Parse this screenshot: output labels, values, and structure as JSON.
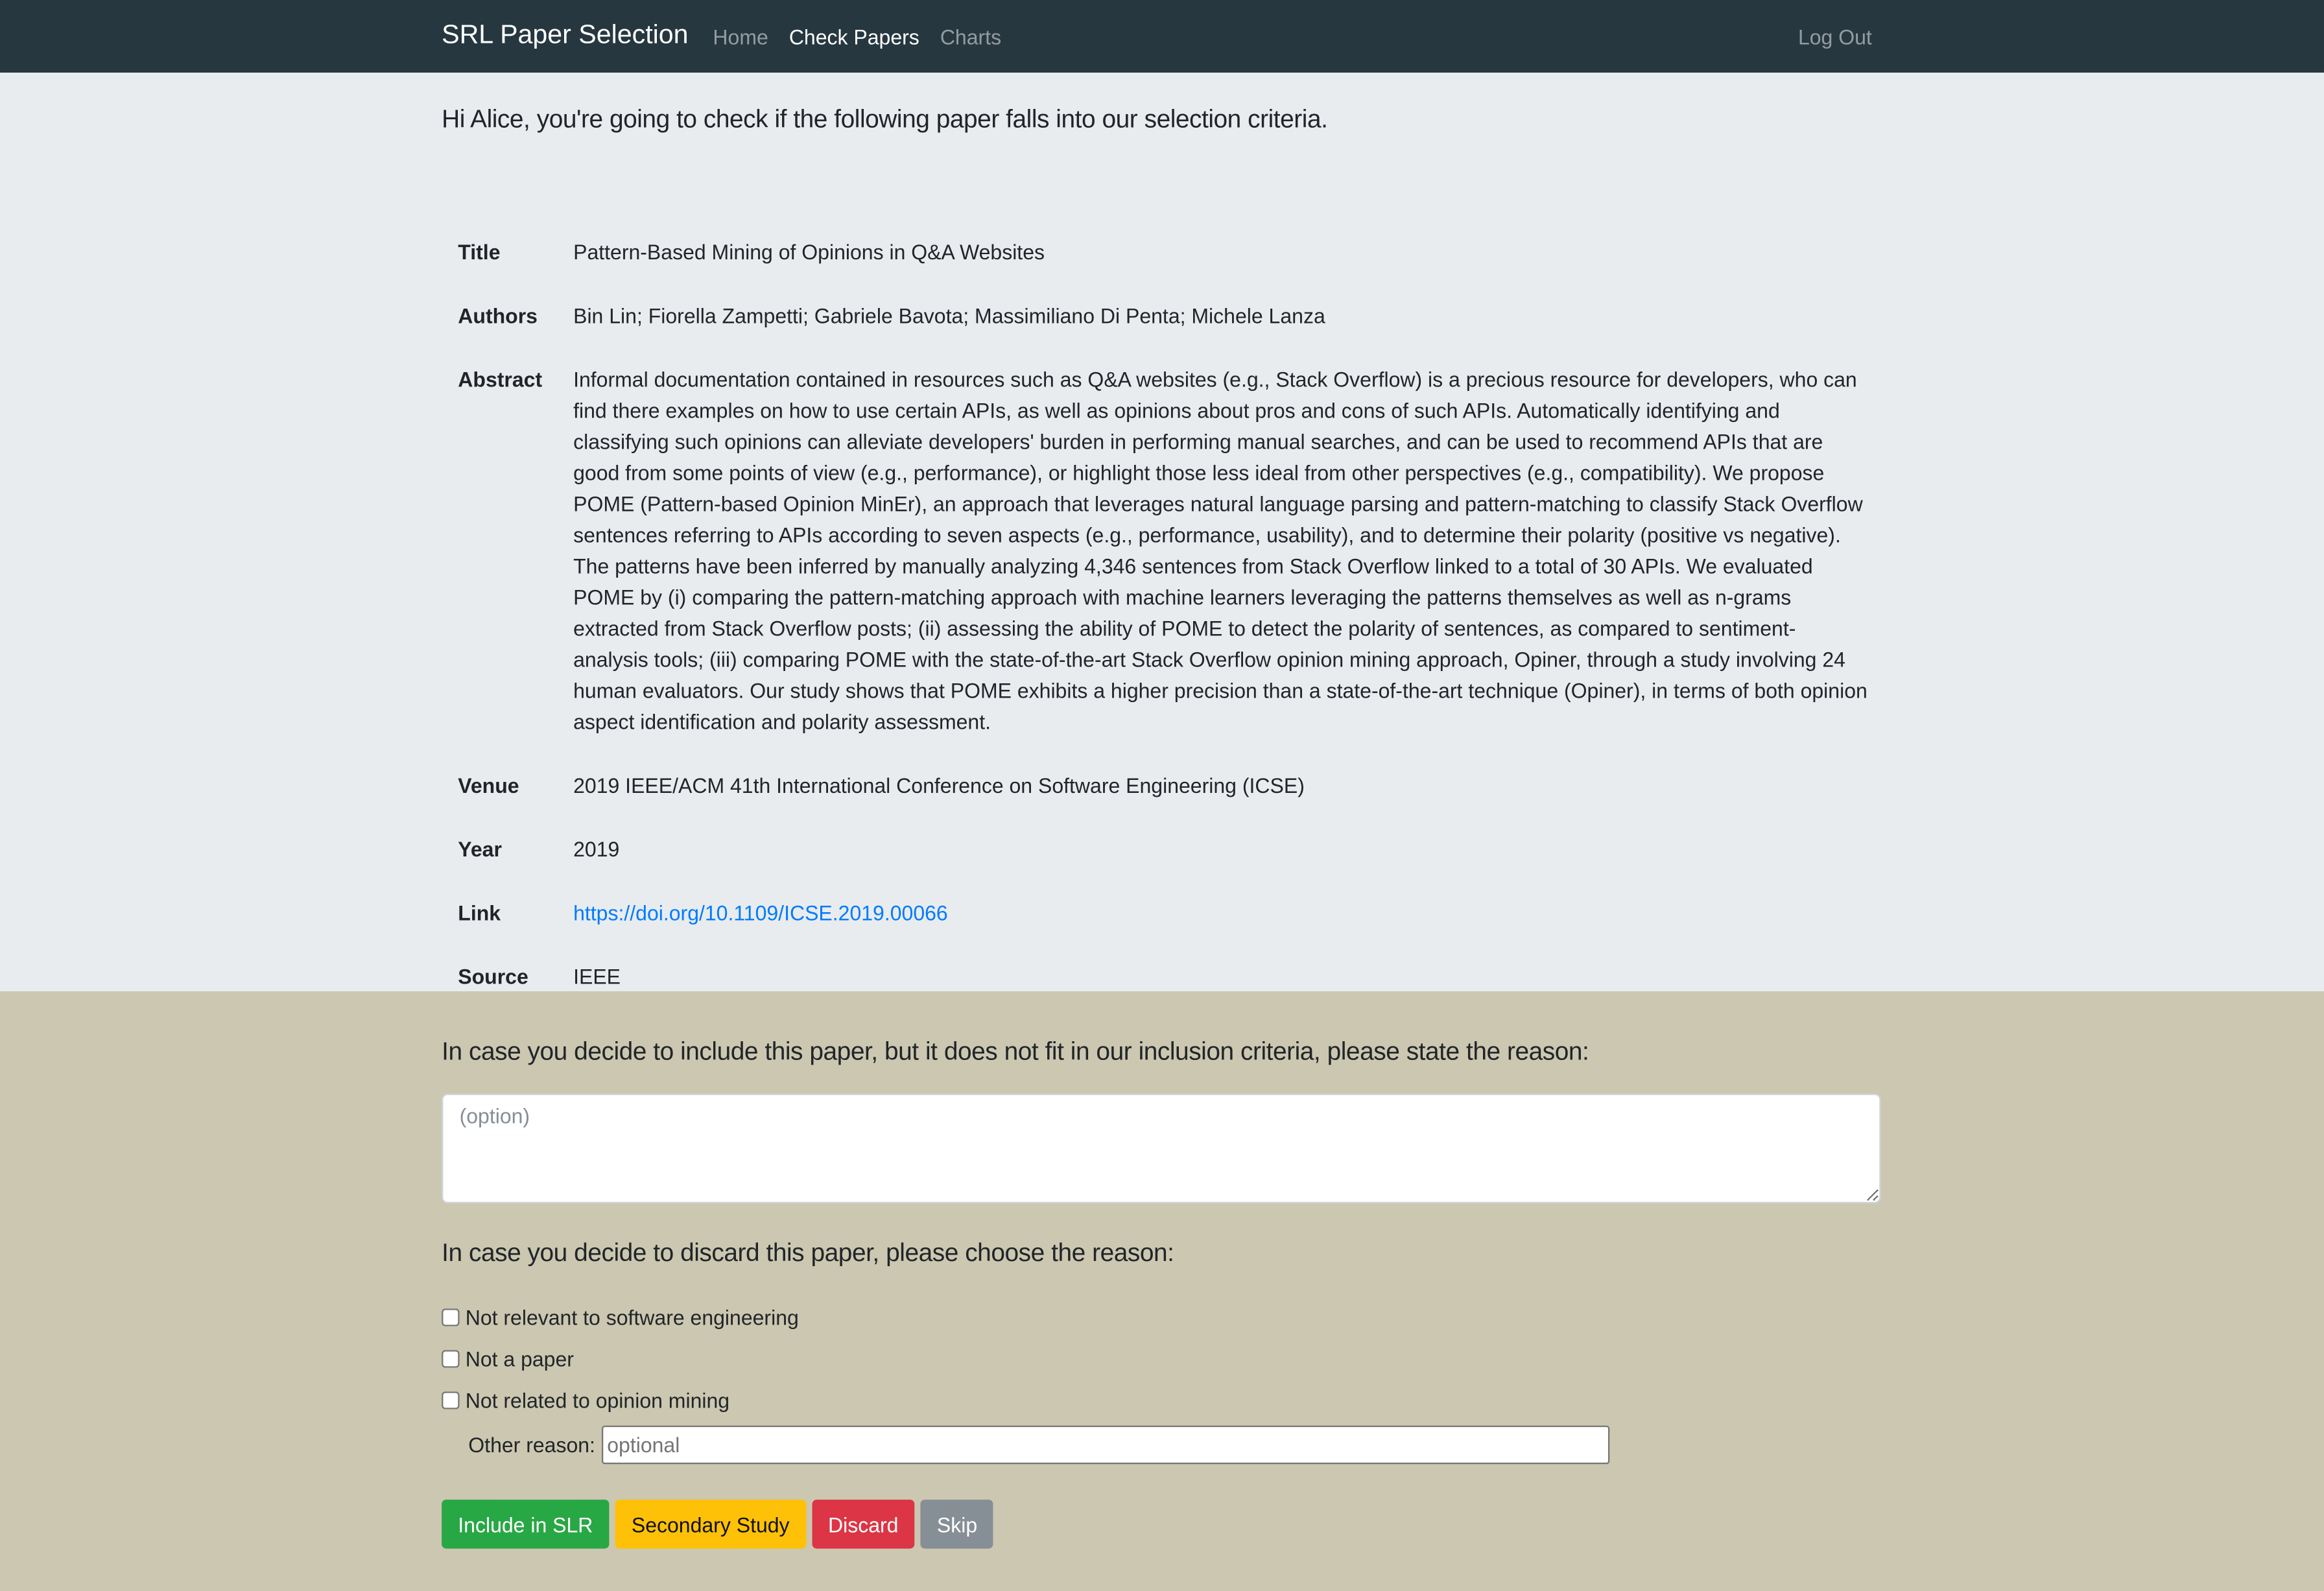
{
  "navbar": {
    "brand": "SRL Paper Selection",
    "links": [
      {
        "label": "Home",
        "active": false
      },
      {
        "label": "Check Papers",
        "active": true
      },
      {
        "label": "Charts",
        "active": false
      }
    ],
    "logout": "Log Out"
  },
  "intro": "Hi Alice, you're going to check if the following paper falls into our selection criteria.",
  "paper": {
    "fields": [
      {
        "key": "Title",
        "value": "Pattern-Based Mining of Opinions in Q&A Websites"
      },
      {
        "key": "Authors",
        "value": "Bin Lin; Fiorella Zampetti; Gabriele Bavota; Massimiliano Di Penta; Michele Lanza"
      },
      {
        "key": "Abstract",
        "value": "Informal documentation contained in resources such as Q&A websites (e.g., Stack Overflow) is a precious resource for developers, who can find there examples on how to use certain APIs, as well as opinions about pros and cons of such APIs. Automatically identifying and classifying such opinions can alleviate developers' burden in performing manual searches, and can be used to recommend APIs that are good from some points of view (e.g., performance), or highlight those less ideal from other perspectives (e.g., compatibility). We propose POME (Pattern-based Opinion MinEr), an approach that leverages natural language parsing and pattern-matching to classify Stack Overflow sentences referring to APIs according to seven aspects (e.g., performance, usability), and to determine their polarity (positive vs negative). The patterns have been inferred by manually analyzing 4,346 sentences from Stack Overflow linked to a total of 30 APIs. We evaluated POME by (i) comparing the pattern-matching approach with machine learners leveraging the patterns themselves as well as n-grams extracted from Stack Overflow posts; (ii) assessing the ability of POME to detect the polarity of sentences, as compared to sentiment-analysis tools; (iii) comparing POME with the state-of-the-art Stack Overflow opinion mining approach, Opiner, through a study involving 24 human evaluators. Our study shows that POME exhibits a higher precision than a state-of-the-art technique (Opiner), in terms of both opinion aspect identification and polarity assessment."
      },
      {
        "key": "Venue",
        "value": "2019 IEEE/ACM 41th International Conference on Software Engineering (ICSE)"
      },
      {
        "key": "Year",
        "value": "2019"
      },
      {
        "key": "Link",
        "value": "https://doi.org/10.1109/ICSE.2019.00066"
      },
      {
        "key": "Source",
        "value": "IEEE"
      }
    ]
  },
  "include_section": {
    "prompt": "In case you decide to include this paper, but it does not fit in our inclusion criteria, please state the reason:",
    "textarea_placeholder": "(option)",
    "textarea_value": ""
  },
  "discard_section": {
    "prompt": "In case you decide to discard this paper, please choose the reason:",
    "options": [
      {
        "label": "Not relevant to software engineering",
        "checked": false
      },
      {
        "label": "Not a paper",
        "checked": false
      },
      {
        "label": "Not related to opinion mining",
        "checked": false
      }
    ],
    "other_label": "Other reason:",
    "other_placeholder": "optional",
    "other_value": ""
  },
  "actions": {
    "include": "Include in SLR",
    "secondary": "Secondary Study",
    "discard": "Discard",
    "skip": "Skip"
  },
  "colors": {
    "navbar_bg": "#263740",
    "upper_bg": "#e9ecef",
    "lower_bg": "#ccc7b0",
    "link": "#007bff",
    "success": "#28a745",
    "warning": "#ffc107",
    "danger": "#dc3545",
    "secondary": "#868e96"
  }
}
